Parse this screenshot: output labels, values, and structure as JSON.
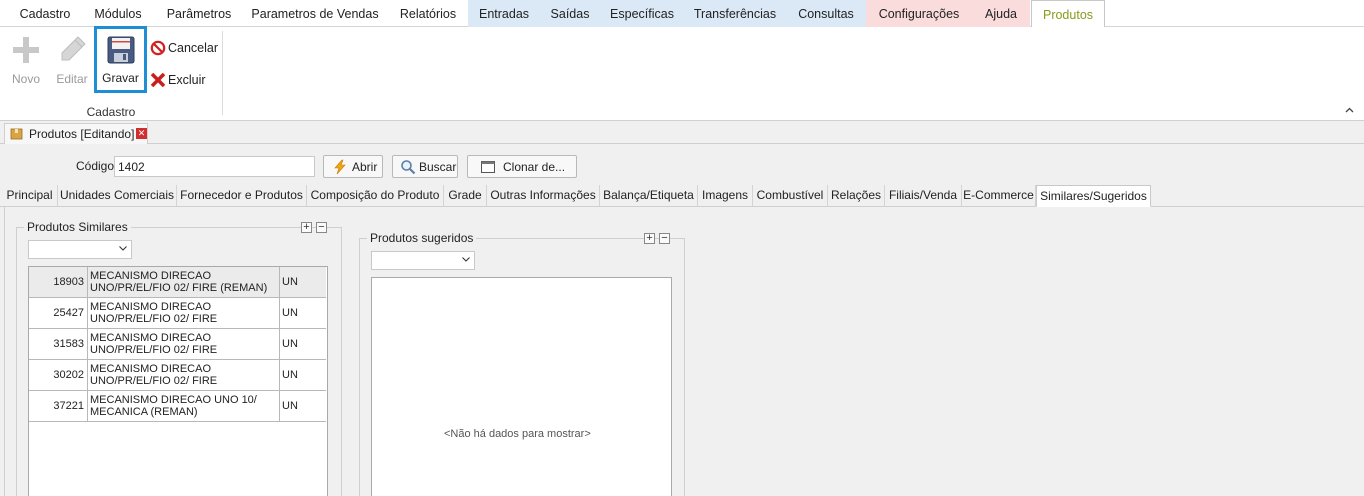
{
  "menu": {
    "items": [
      {
        "label": "Cadastro"
      },
      {
        "label": "Módulos"
      },
      {
        "label": "Parâmetros"
      },
      {
        "label": "Parametros de Vendas"
      },
      {
        "label": "Relatórios"
      },
      {
        "label": "Entradas"
      },
      {
        "label": "Saídas"
      },
      {
        "label": "Específicas"
      },
      {
        "label": "Transferências"
      },
      {
        "label": "Consultas"
      },
      {
        "label": "Configurações"
      },
      {
        "label": "Ajuda"
      },
      {
        "label": "Produtos"
      }
    ]
  },
  "ribbon": {
    "novo": "Novo",
    "editar": "Editar",
    "gravar": "Gravar",
    "cancelar": "Cancelar",
    "excluir": "Excluir",
    "group_label": "Cadastro"
  },
  "doc_tab": {
    "title": "Produtos [Editando]"
  },
  "form": {
    "codigo_label": "Código",
    "codigo_value": "1402",
    "abrir": "Abrir",
    "buscar": "Buscar",
    "clonar": "Clonar de..."
  },
  "subtabs": [
    {
      "label": "Principal"
    },
    {
      "label": "Unidades Comerciais"
    },
    {
      "label": "Fornecedor e Produtos"
    },
    {
      "label": "Composição do Produto"
    },
    {
      "label": "Grade"
    },
    {
      "label": "Outras Informações"
    },
    {
      "label": "Balança/Etiqueta"
    },
    {
      "label": "Imagens"
    },
    {
      "label": "Combustível"
    },
    {
      "label": "Relações"
    },
    {
      "label": "Filiais/Venda"
    },
    {
      "label": "E-Commerce"
    },
    {
      "label": "Similares/Sugeridos"
    }
  ],
  "similares": {
    "title": "Produtos Similares",
    "rows": [
      {
        "code": "18903",
        "desc": "MECANISMO DIRECAO UNO/PR/EL/FIO 02/ FIRE (REMAN)",
        "unit": "UN"
      },
      {
        "code": "25427",
        "desc": "MECANISMO DIRECAO UNO/PR/EL/FIO 02/ FIRE",
        "unit": "UN"
      },
      {
        "code": "31583",
        "desc": "MECANISMO DIRECAO UNO/PR/EL/FIO 02/ FIRE",
        "unit": "UN"
      },
      {
        "code": "30202",
        "desc": "MECANISMO DIRECAO UNO/PR/EL/FIO 02/ FIRE",
        "unit": "UN"
      },
      {
        "code": "37221",
        "desc": "MECANISMO DIRECAO UNO 10/ MECANICA (REMAN)",
        "unit": "UN"
      }
    ]
  },
  "sugeridos": {
    "title": "Produtos sugeridos",
    "empty": "<Não há dados para mostrar>"
  },
  "colors": {
    "selected_border": "#1e8fd5",
    "menu_blue": "#dbe9f7",
    "menu_pink": "#fbdcdc",
    "active_tab_text": "#8a9a1a"
  }
}
